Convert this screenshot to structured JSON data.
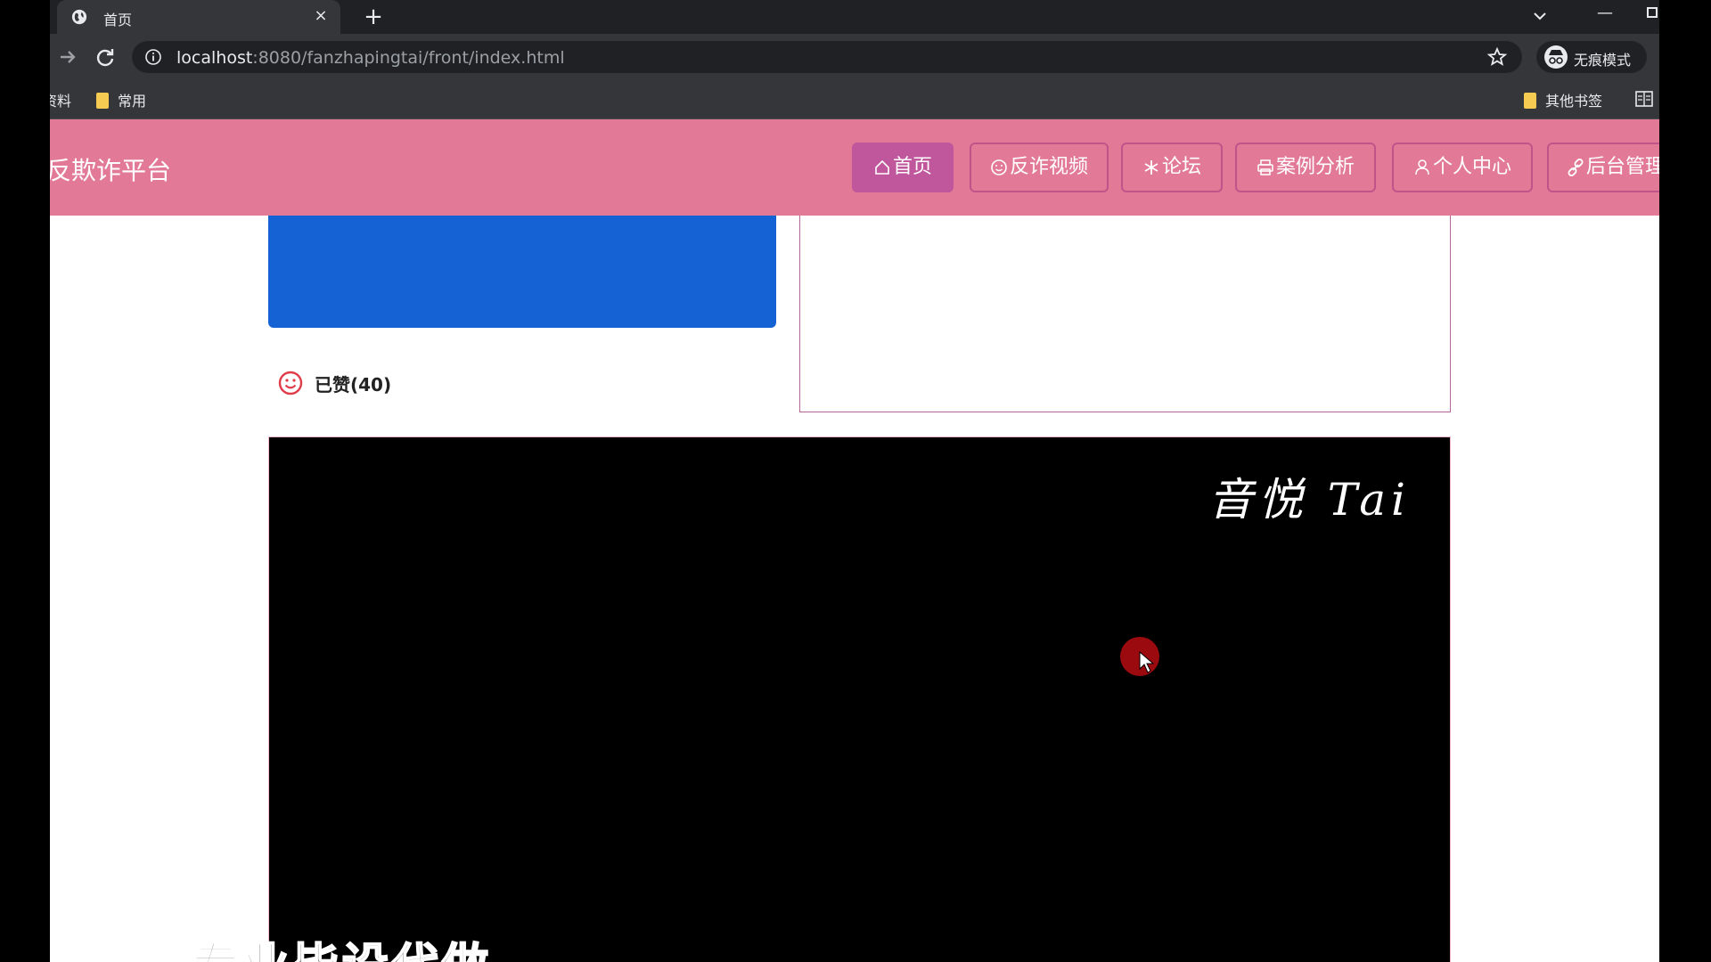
{
  "browser": {
    "tab_title": "首页",
    "tab_close": "×",
    "new_tab": "+",
    "url_host": "localhost",
    "url_path": ":8080/fanzhapingtai/front/index.html",
    "incognito_label": "无痕模式",
    "bookmarks": {
      "item1": "资料",
      "item2": "常用",
      "other": "其他书签"
    }
  },
  "header": {
    "brand": "反欺诈平台",
    "nav": [
      {
        "label": "首页",
        "icon": "home-icon"
      },
      {
        "label": "反诈视频",
        "icon": "smiley-icon"
      },
      {
        "label": "论坛",
        "icon": "snowflake-icon"
      },
      {
        "label": "案例分析",
        "icon": "printer-icon"
      },
      {
        "label": "个人中心",
        "icon": "user-icon"
      },
      {
        "label": "后台管理",
        "icon": "link-icon"
      }
    ],
    "active_index": 0
  },
  "content": {
    "like_text": "已赞(40)",
    "watermark": "音悦 Tai",
    "subtitle": "专业毕设代做"
  },
  "colors": {
    "header_bg": "#e27a97",
    "nav_active_bg": "#c0569c",
    "blue_box": "#1562d4",
    "like_icon": "#e03c4a"
  }
}
